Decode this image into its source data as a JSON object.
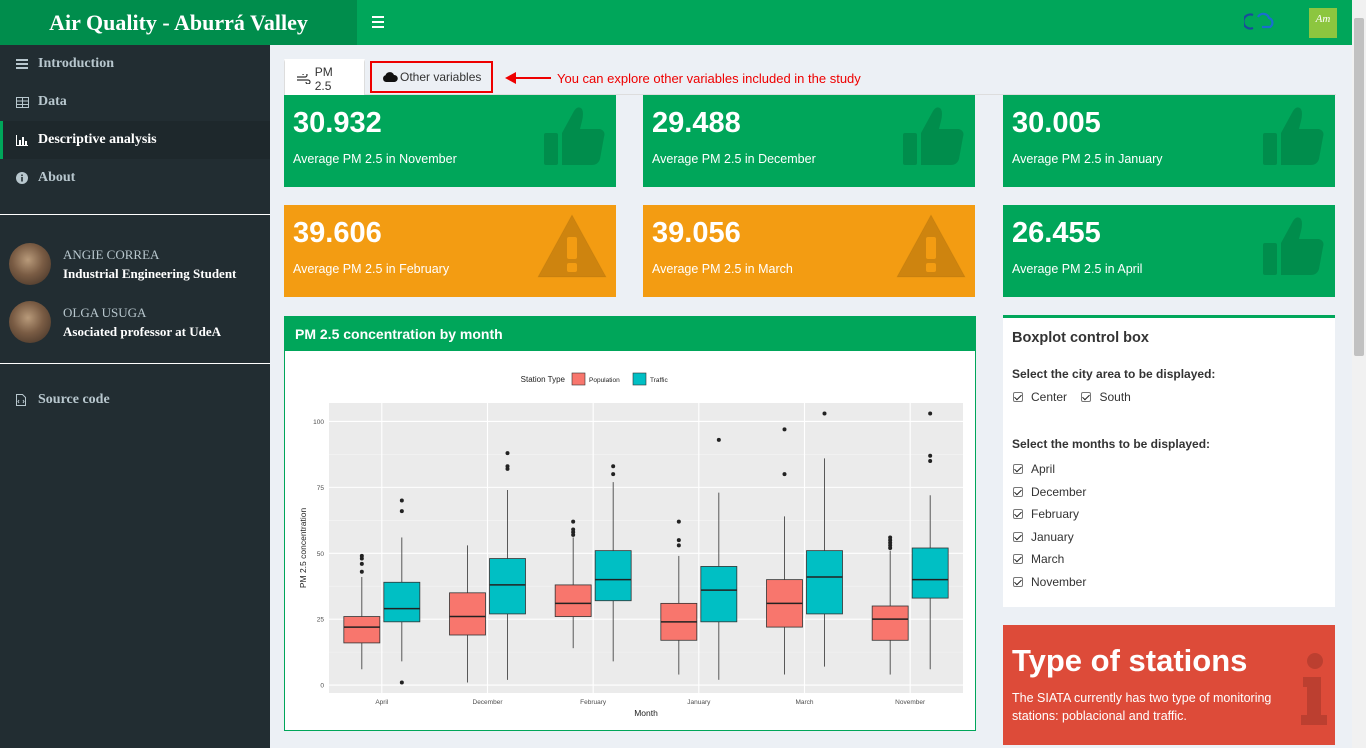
{
  "header": {
    "title": "Air Quality - Aburrá Valley",
    "brand_logo_text": "Am"
  },
  "sidebar": {
    "items": [
      {
        "label": "Introduction",
        "icon": "list-icon"
      },
      {
        "label": "Data",
        "icon": "table-icon"
      },
      {
        "label": "Descriptive analysis",
        "icon": "bar-chart-icon"
      },
      {
        "label": "About",
        "icon": "info-icon"
      }
    ],
    "people": [
      {
        "name": "ANGIE CORREA",
        "role": "Industrial Engineering Student"
      },
      {
        "name": "OLGA USUGA",
        "role": "Asociated professor at UdeA"
      }
    ],
    "source_code": "Source code"
  },
  "tabs": [
    {
      "label": "PM 2.5",
      "icon": "wind-icon"
    },
    {
      "label": "Other variables",
      "icon": "cloud-icon"
    }
  ],
  "annotation": "You can explore other variables included in the study",
  "value_boxes": [
    {
      "value": "30.932",
      "label": "Average PM 2.5 in November",
      "status": "good",
      "color": "#00a65a",
      "icon": "thumbs-up-icon"
    },
    {
      "value": "29.488",
      "label": "Average PM 2.5 in December",
      "status": "good",
      "color": "#00a65a",
      "icon": "thumbs-up-icon"
    },
    {
      "value": "30.005",
      "label": "Average PM 2.5 in January",
      "status": "good",
      "color": "#00a65a",
      "icon": "thumbs-up-icon"
    },
    {
      "value": "39.606",
      "label": "Average PM 2.5 in February",
      "status": "warning",
      "color": "#f39c12",
      "icon": "warning-icon"
    },
    {
      "value": "39.056",
      "label": "Average PM 2.5 in March",
      "status": "warning",
      "color": "#f39c12",
      "icon": "warning-icon"
    },
    {
      "value": "26.455",
      "label": "Average PM 2.5 in April",
      "status": "good",
      "color": "#00a65a",
      "icon": "thumbs-up-icon"
    }
  ],
  "chart_box_title": "PM 2.5 concentration by month",
  "chart_data": {
    "type": "boxplot",
    "xlabel": "Month",
    "ylabel": "PM 2.5 concentration",
    "ylim": [
      -3,
      107
    ],
    "yticks": [
      0,
      25,
      50,
      75,
      100
    ],
    "legend_title": "Station Type",
    "legend_position": "top",
    "grid": true,
    "categories": [
      "April",
      "December",
      "February",
      "January",
      "March",
      "November"
    ],
    "series": [
      {
        "name": "Population",
        "color": "#f8766d",
        "boxes": [
          {
            "min": 6,
            "q1": 16,
            "median": 22,
            "q3": 26,
            "max": 41,
            "outliers": [
              43,
              46,
              48,
              49
            ]
          },
          {
            "min": 1,
            "q1": 19,
            "median": 26,
            "q3": 35,
            "max": 53,
            "outliers": []
          },
          {
            "min": 14,
            "q1": 26,
            "median": 31,
            "q3": 38,
            "max": 56,
            "outliers": [
              57,
              58,
              59,
              62
            ]
          },
          {
            "min": 4,
            "q1": 17,
            "median": 24,
            "q3": 31,
            "max": 49,
            "outliers": [
              53,
              55,
              62
            ]
          },
          {
            "min": 4,
            "q1": 22,
            "median": 31,
            "q3": 40,
            "max": 64,
            "outliers": [
              80,
              97
            ]
          },
          {
            "min": 4,
            "q1": 17,
            "median": 25,
            "q3": 30,
            "max": 51,
            "outliers": [
              52,
              53,
              54,
              55,
              56
            ]
          }
        ]
      },
      {
        "name": "Traffic",
        "color": "#00bfc4",
        "boxes": [
          {
            "min": 9,
            "q1": 24,
            "median": 29,
            "q3": 39,
            "max": 56,
            "outliers": [
              1,
              66,
              70
            ]
          },
          {
            "min": 2,
            "q1": 27,
            "median": 38,
            "q3": 48,
            "max": 74,
            "outliers": [
              82,
              83,
              88
            ]
          },
          {
            "min": 9,
            "q1": 32,
            "median": 40,
            "q3": 51,
            "max": 77,
            "outliers": [
              80,
              83
            ]
          },
          {
            "min": 2,
            "q1": 24,
            "median": 36,
            "q3": 45,
            "max": 73,
            "outliers": [
              93
            ]
          },
          {
            "min": 7,
            "q1": 27,
            "median": 41,
            "q3": 51,
            "max": 86,
            "outliers": [
              103
            ]
          },
          {
            "min": 6,
            "q1": 33,
            "median": 40,
            "q3": 52,
            "max": 72,
            "outliers": [
              85,
              87,
              103
            ]
          }
        ]
      }
    ]
  },
  "control_box": {
    "title": "Boxplot control box",
    "area_label": "Select the city area to be displayed:",
    "areas": [
      "Center",
      "South"
    ],
    "months_label": "Select the months to be displayed:",
    "months": [
      "April",
      "December",
      "February",
      "January",
      "March",
      "November"
    ]
  },
  "stations_box": {
    "title": "Type of stations",
    "description": "The SIATA currently has two type of monitoring stations: poblacional and traffic.",
    "icon": "info-icon",
    "color": "#dd4b39"
  }
}
